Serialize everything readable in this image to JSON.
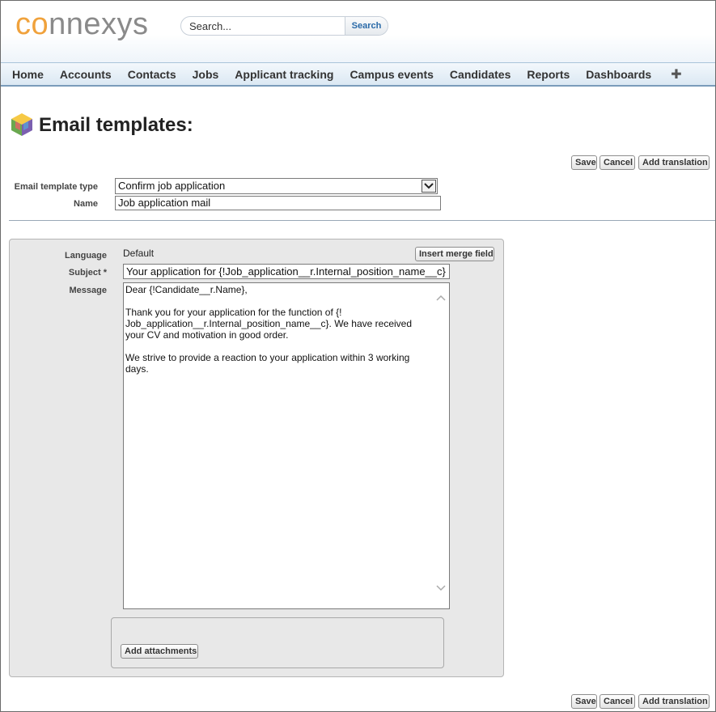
{
  "header": {
    "logo_part1": "co",
    "logo_part2": "nnexys",
    "search_placeholder": "Search...",
    "search_button": "Search"
  },
  "nav": {
    "items": [
      "Home",
      "Accounts",
      "Contacts",
      "Jobs",
      "Applicant tracking",
      "Campus events",
      "Candidates",
      "Reports",
      "Dashboards"
    ],
    "add_tab_symbol": "✚"
  },
  "page": {
    "title": "Email templates:"
  },
  "buttons": {
    "save": "Save",
    "cancel": "Cancel",
    "add_translation": "Add translation",
    "insert_merge_field": "Insert merge field",
    "add_attachments": "Add attachments"
  },
  "form": {
    "type_label": "Email template type",
    "type_value": "Confirm job application",
    "name_label": "Name",
    "name_value": "Job application mail"
  },
  "editor": {
    "language_label": "Language",
    "language_value": "Default",
    "subject_label": "Subject *",
    "subject_value": "Your application for {!Job_application__r.Internal_position_name__c}",
    "message_label": "Message",
    "message_value": "Dear {!Candidate__r.Name},\n\nThank you for your application for the function of {!\nJob_application__r.Internal_position_name__c}. We have received\nyour CV and motivation in good order.\n\nWe strive to provide a reaction to your application within 3 working\ndays."
  },
  "colors": {
    "nav_border": "#7a9cba",
    "search_button_text": "#2a6aa8",
    "logo_accent": "#f0a23c"
  }
}
